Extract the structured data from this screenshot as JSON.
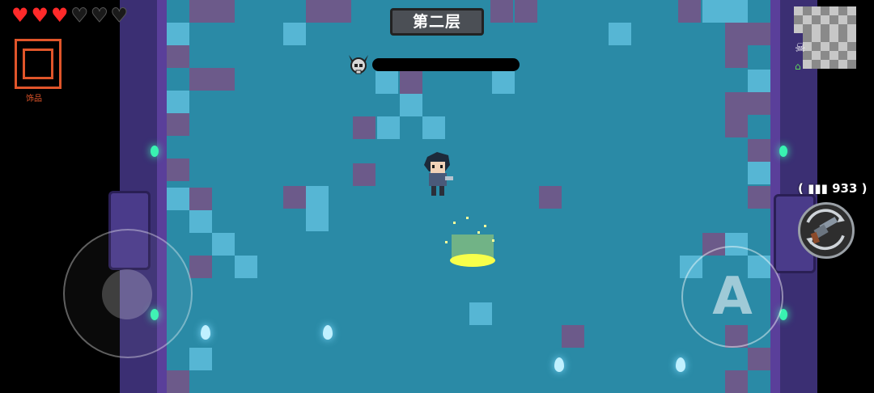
{
  "hud": {
    "hearts": [
      "full",
      "full",
      "full",
      "empty",
      "empty",
      "empty"
    ],
    "accessory_label": "饰品",
    "level_title": "第二层",
    "ammo_count": "933",
    "attack_label": "A"
  },
  "icons": {
    "heart_full": "heart-icon",
    "heart_empty": "heart-empty-icon",
    "boss": "horned-skull-icon",
    "weapon": "revolver-icon",
    "swap": "swap-arrows-icon",
    "minimap_skull": "skull-icon",
    "minimap_home": "home-icon"
  },
  "colors": {
    "floor": "#2a8aa6",
    "floor_tile_light": "#56b6d4",
    "floor_tile_dark": "#6c5a8a",
    "wall": "#3b2f73",
    "heart": "#ff2a2a",
    "accessory_frame": "#e0552a",
    "torch": "#39f2b1",
    "portal": "#f7ff4a"
  }
}
